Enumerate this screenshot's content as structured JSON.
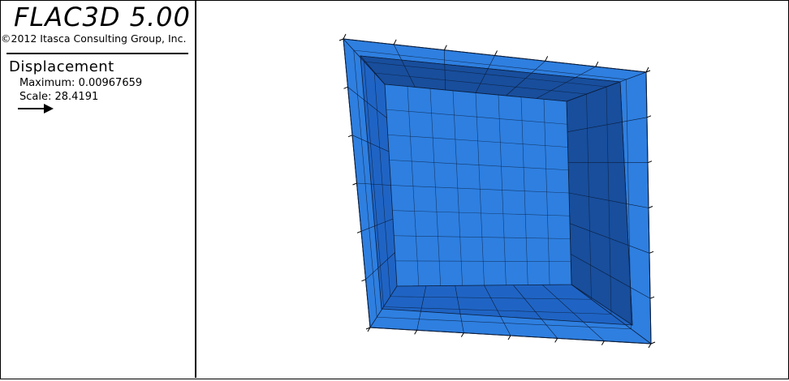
{
  "app": {
    "title": "FLAC3D 5.00",
    "copyright": "©2012 Itasca Consulting Group, Inc."
  },
  "legend": {
    "heading": "Displacement",
    "maximum": "Maximum: 0.00967659",
    "scale": "Scale: 28.4191",
    "arrow_icon": "right-arrow-icon"
  },
  "model": {
    "face_color": "#2e7fe0",
    "inner_wall_color": "#1f64c4",
    "dark_wall_color": "#184e9c",
    "grid_color": "#0c1e3c"
  }
}
